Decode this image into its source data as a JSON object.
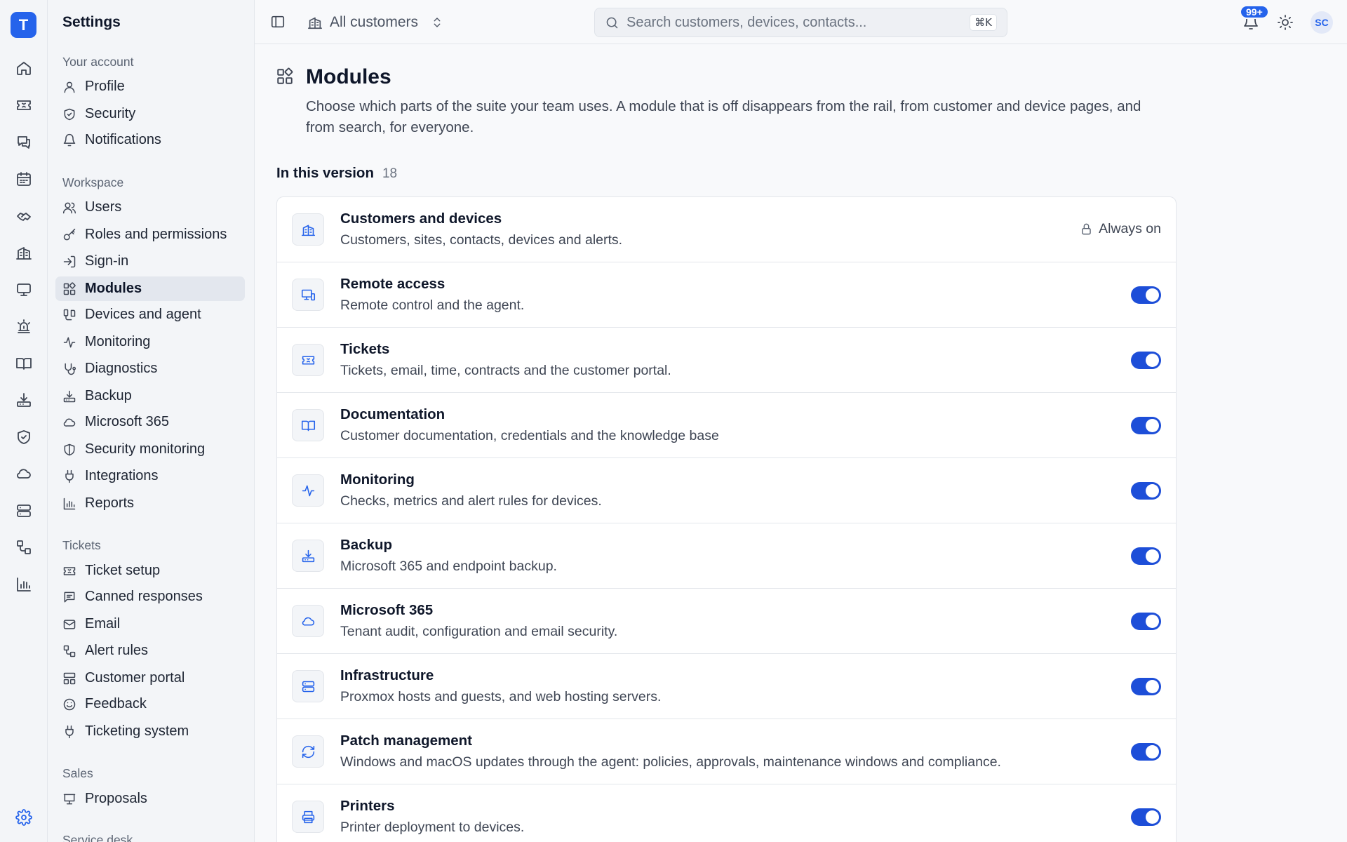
{
  "app": {
    "logo_letter": "T"
  },
  "rail": {
    "items": [
      {
        "name": "home-icon"
      },
      {
        "name": "ticket-icon"
      },
      {
        "name": "chat-icon"
      },
      {
        "name": "calendar-icon"
      },
      {
        "name": "handshake-icon"
      },
      {
        "name": "building-icon"
      },
      {
        "name": "monitor-icon"
      },
      {
        "name": "siren-icon"
      },
      {
        "name": "book-icon"
      },
      {
        "name": "backup-icon"
      },
      {
        "name": "shield-check-icon"
      },
      {
        "name": "cloud-icon"
      },
      {
        "name": "server-icon"
      },
      {
        "name": "workflow-icon"
      },
      {
        "name": "bar-chart-icon"
      },
      {
        "name": "gear-icon"
      }
    ]
  },
  "sidebar": {
    "title": "Settings",
    "groups": [
      {
        "label": "Your account",
        "items": [
          "Profile",
          "Security",
          "Notifications"
        ]
      },
      {
        "label": "Workspace",
        "items": [
          "Users",
          "Roles and permissions",
          "Sign-in",
          "Modules",
          "Devices and agent",
          "Monitoring",
          "Diagnostics",
          "Backup",
          "Microsoft 365",
          "Security monitoring",
          "Integrations",
          "Reports"
        ]
      },
      {
        "label": "Tickets",
        "items": [
          "Ticket setup",
          "Canned responses",
          "Email",
          "Alert rules",
          "Customer portal",
          "Feedback",
          "Ticketing system"
        ]
      },
      {
        "label": "Sales",
        "items": [
          "Proposals"
        ]
      },
      {
        "label": "Service desk",
        "items": []
      }
    ],
    "active": "Modules"
  },
  "topbar": {
    "customer_switch": "All customers",
    "search": {
      "placeholder": "Search customers, devices, contacts...",
      "shortcut": "⌘K"
    },
    "notifications_badge": "99+",
    "avatar_initials": "SC"
  },
  "page": {
    "title": "Modules",
    "description": "Choose which parts of the suite your team uses. A module that is off disappears from the rail, from customer and device pages, and from search, for everyone.",
    "section": {
      "title": "In this version",
      "count": "18"
    },
    "modules": [
      {
        "name": "Customers and devices",
        "desc": "Customers, sites, contacts, devices and alerts.",
        "always_on": "Always on",
        "enabled": true,
        "icon": "building-icon"
      },
      {
        "name": "Remote access",
        "desc": "Remote control and the agent.",
        "enabled": true,
        "icon": "remote-screen-icon"
      },
      {
        "name": "Tickets",
        "desc": "Tickets, email, time, contracts and the customer portal.",
        "enabled": true,
        "icon": "ticket-icon"
      },
      {
        "name": "Documentation",
        "desc": "Customer documentation, credentials and the knowledge base",
        "enabled": true,
        "icon": "book-icon"
      },
      {
        "name": "Monitoring",
        "desc": "Checks, metrics and alert rules for devices.",
        "enabled": true,
        "icon": "pulse-icon"
      },
      {
        "name": "Backup",
        "desc": "Microsoft 365 and endpoint backup.",
        "enabled": true,
        "icon": "backup-icon"
      },
      {
        "name": "Microsoft 365",
        "desc": "Tenant audit, configuration and email security.",
        "enabled": true,
        "icon": "cloud-icon"
      },
      {
        "name": "Infrastructure",
        "desc": "Proxmox hosts and guests, and web hosting servers.",
        "enabled": true,
        "icon": "server-icon"
      },
      {
        "name": "Patch management",
        "desc": "Windows and macOS updates through the agent: policies, approvals, maintenance windows and compliance.",
        "enabled": true,
        "icon": "refresh-icon"
      },
      {
        "name": "Printers",
        "desc": "Printer deployment to devices.",
        "enabled": true,
        "icon": "printer-icon"
      }
    ]
  },
  "colors": {
    "accent": "#2563eb",
    "toggle_on": "#1d4ed8"
  }
}
